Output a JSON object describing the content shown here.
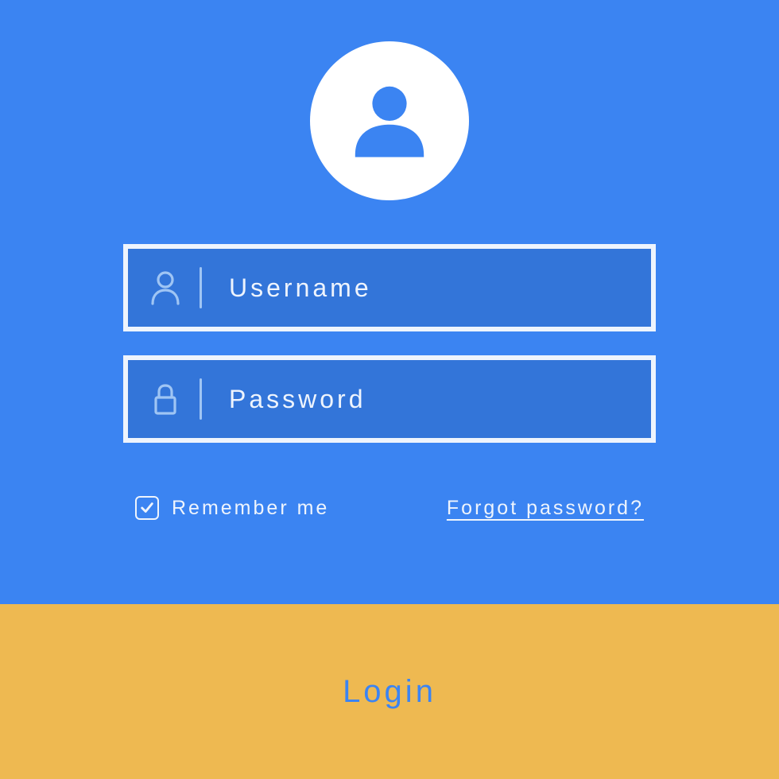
{
  "colors": {
    "bg": "#3b84f2",
    "field_bg": "#3375d9",
    "field_border": "#eef4fd",
    "icon_stroke": "#9fc5f4",
    "login_bg": "#eeb951",
    "login_text": "#3b84f2",
    "text_light": "#eef4fd",
    "avatar_bg": "#ffffff"
  },
  "avatar": {
    "icon": "user-icon"
  },
  "fields": {
    "username": {
      "icon": "person-icon",
      "placeholder": "Username",
      "value": ""
    },
    "password": {
      "icon": "lock-icon",
      "placeholder": "Password",
      "value": ""
    }
  },
  "remember": {
    "label": "Remember me",
    "checked": true
  },
  "forgot": {
    "label": "Forgot password?"
  },
  "login": {
    "label": "Login"
  }
}
